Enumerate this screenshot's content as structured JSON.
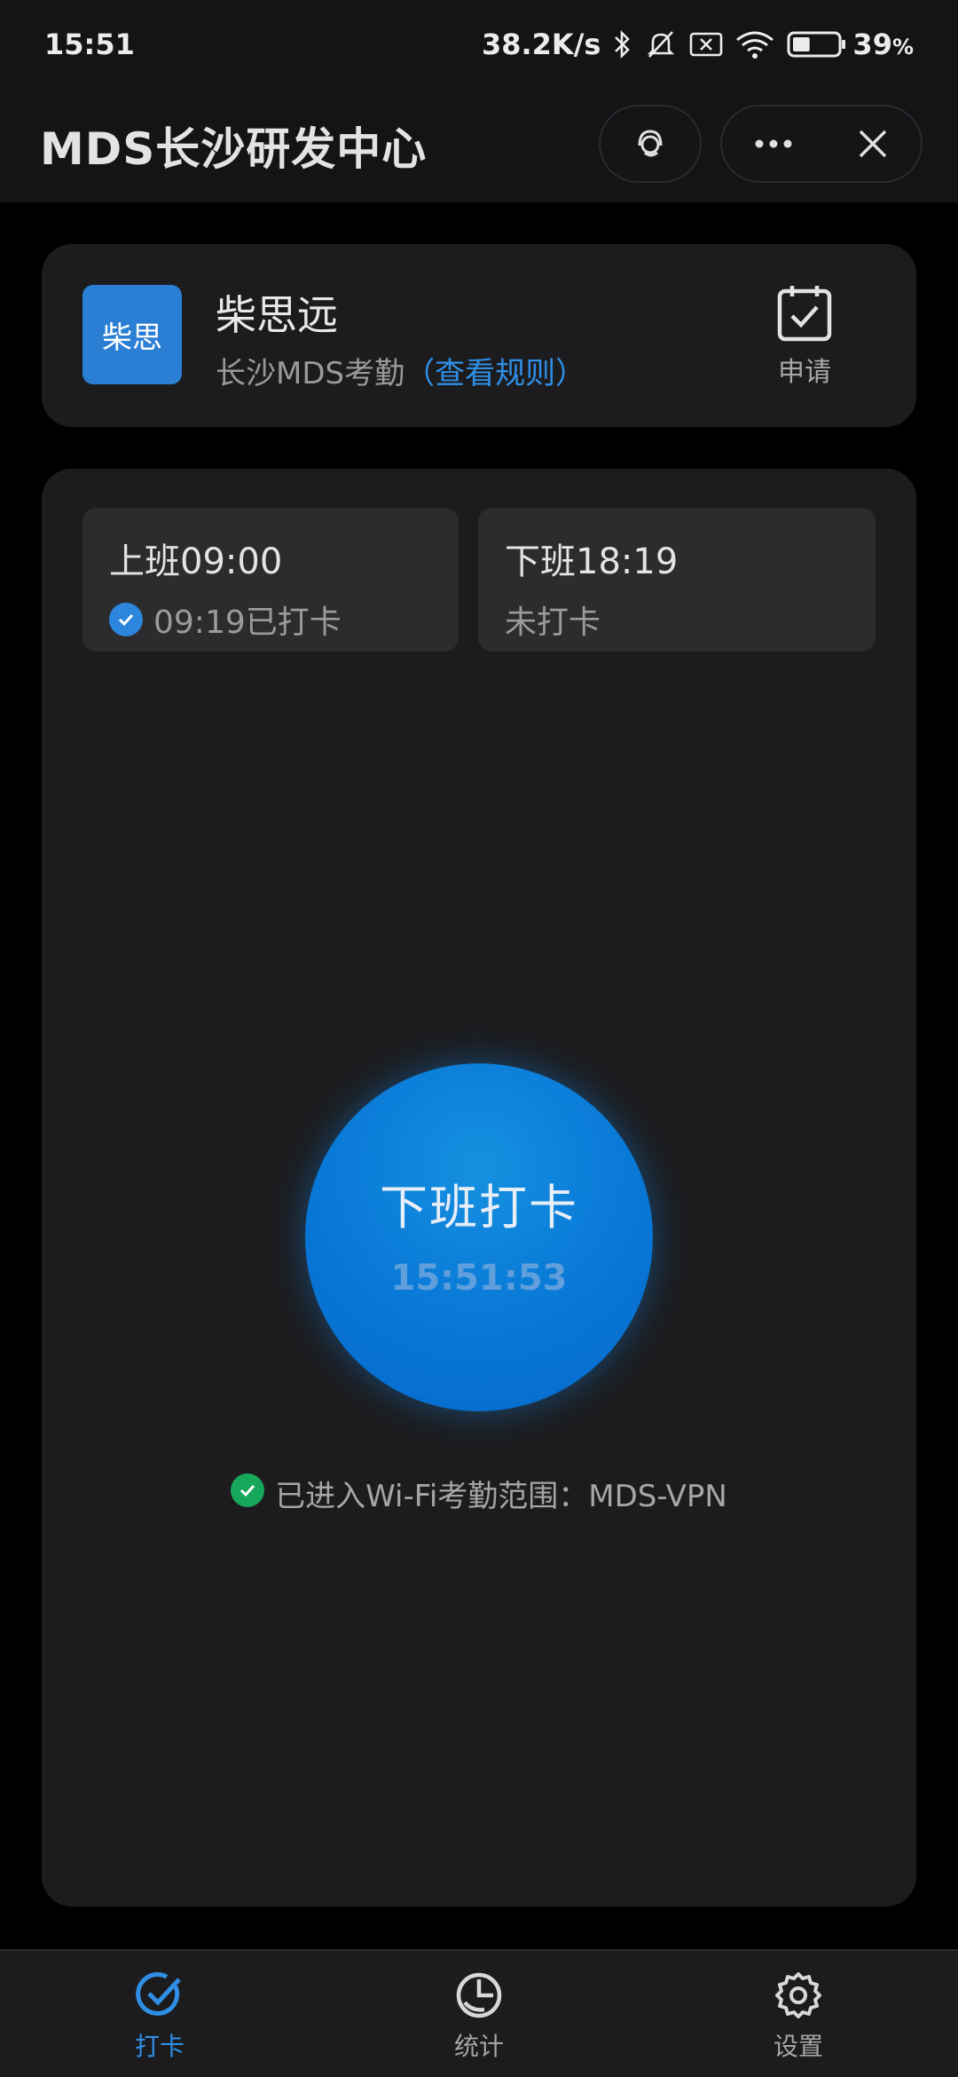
{
  "status_bar": {
    "time": "15:51",
    "net_speed": "38.2K/s",
    "battery_percent": "39",
    "battery_unit": "%",
    "battery_level": 0.39,
    "icons": [
      "bluetooth-icon",
      "mute-icon",
      "sim-icon",
      "wifi-icon",
      "battery-icon"
    ]
  },
  "header": {
    "title": "MDS长沙研发中心"
  },
  "user_card": {
    "avatar_text": "柴思",
    "name": "柴思远",
    "group": "长沙MDS考勤",
    "rules_link": "（查看规则）",
    "apply_label": "申请"
  },
  "shifts": [
    {
      "title": "上班09:00",
      "status": "09:19已打卡",
      "checked": true
    },
    {
      "title": "下班18:19",
      "status": "未打卡",
      "checked": false
    }
  ],
  "clock_button": {
    "label": "下班打卡",
    "time": "15:51:53"
  },
  "wifi_status": "已进入Wi-Fi考勤范围：MDS-VPN",
  "tabs": [
    {
      "label": "打卡",
      "icon": "check-icon",
      "active": true
    },
    {
      "label": "统计",
      "icon": "pie-chart-icon",
      "active": false
    },
    {
      "label": "设置",
      "icon": "gear-icon",
      "active": false
    }
  ],
  "colors": {
    "accent": "#2f8fe6",
    "success": "#17a75a",
    "background": "#000000",
    "card": "#1c1c1e"
  }
}
